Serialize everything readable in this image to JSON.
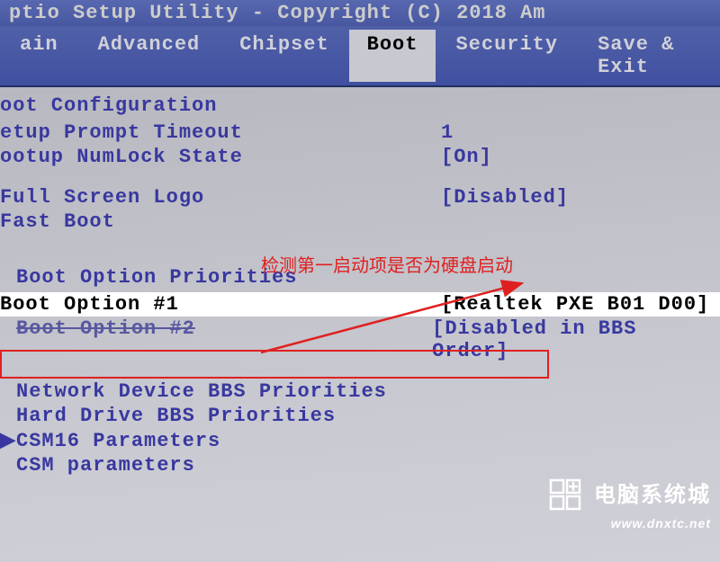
{
  "header": {
    "title": "ptio Setup Utility - Copyright (C) 2018 Am"
  },
  "menu": {
    "items": [
      "ain",
      "Advanced",
      "Chipset",
      "Boot",
      "Security",
      "Save & Exit"
    ],
    "active": "Boot"
  },
  "sections": {
    "boot_config_title": "oot Configuration",
    "setup_prompt": {
      "label": "etup Prompt Timeout",
      "value": "1"
    },
    "numlock": {
      "label": "ootup NumLock State",
      "value": "[On]"
    },
    "fullscreen_logo": {
      "label": "Full Screen Logo",
      "value": "[Disabled]"
    },
    "fast_boot": {
      "label": "Fast Boot",
      "value": ""
    },
    "priorities_title": "Boot Option Priorities",
    "boot_option_1": {
      "label": "Boot Option #1",
      "value": "[Realtek PXE B01 D00]"
    },
    "boot_option_2": {
      "label": "Boot Option #2",
      "value": "[Disabled in BBS Order]"
    },
    "network_bbs": "Network Device BBS Priorities",
    "hard_drive_bbs": "Hard Drive BBS Priorities",
    "csm16": "CSM16 Parameters",
    "csm": "CSM parameters"
  },
  "annotation": {
    "text": "检测第一启动项是否为硬盘启动"
  },
  "watermark": {
    "title": "电脑系统城",
    "url": "www.dnxtc.net"
  }
}
